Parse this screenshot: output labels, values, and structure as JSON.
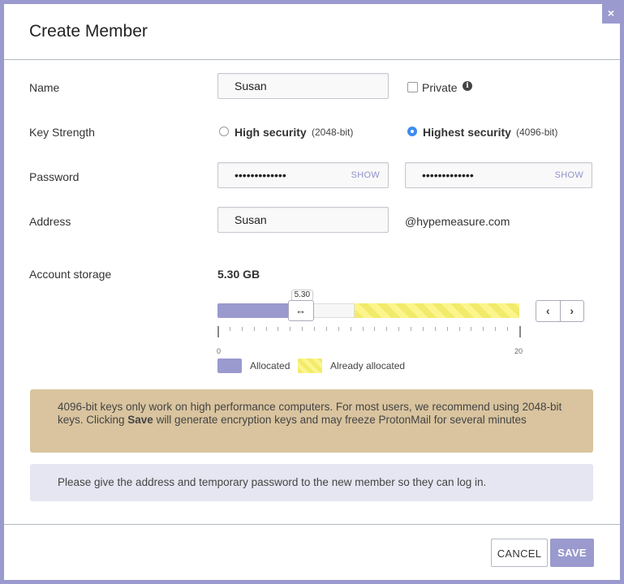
{
  "dialog": {
    "title": "Create Member",
    "close_icon": "×"
  },
  "form": {
    "name": {
      "label": "Name",
      "value": "Susan"
    },
    "private": {
      "label": "Private",
      "checked": false,
      "info_icon": "i"
    },
    "key_strength": {
      "label": "Key Strength",
      "options": [
        {
          "label": "High security",
          "detail": "(2048-bit)",
          "selected": false
        },
        {
          "label": "Highest security",
          "detail": "(4096-bit)",
          "selected": true
        }
      ]
    },
    "password": {
      "label": "Password",
      "value_masked": "•••••••••••••",
      "confirm_masked": "•••••••••••••",
      "show_label": "SHOW"
    },
    "address": {
      "label": "Address",
      "value": "Susan",
      "domain": "@hypemeasure.com"
    },
    "storage": {
      "label": "Account storage",
      "value_display": "5.30 GB",
      "slider_value": 5.3,
      "slider_value_label": "5.30",
      "already_allocated_from": 9.1,
      "min": 0,
      "max": 20,
      "min_label": "0",
      "max_label": "20",
      "handle_icon": "↔",
      "prev_icon": "‹",
      "next_icon": "›",
      "legend": {
        "allocated": "Allocated",
        "already_allocated": "Already allocated"
      }
    }
  },
  "alerts": {
    "warning_pre": "4096-bit keys only work on high performance computers. For most users, we recommend using 2048-bit keys. Clicking ",
    "warning_bold": "Save",
    "warning_post": " will generate encryption keys and may freeze ProtonMail for several minutes",
    "info": "Please give the address and temporary password to the new member so they can log in."
  },
  "footer": {
    "cancel_label": "CANCEL",
    "save_label": "SAVE"
  },
  "colors": {
    "accent": "#9a9acf",
    "radio_selected": "#3d8bf2",
    "warning_bg": "#d9c49f",
    "info_bg": "#e6e6f2",
    "stripe_yellow": "#f2ea6a"
  }
}
